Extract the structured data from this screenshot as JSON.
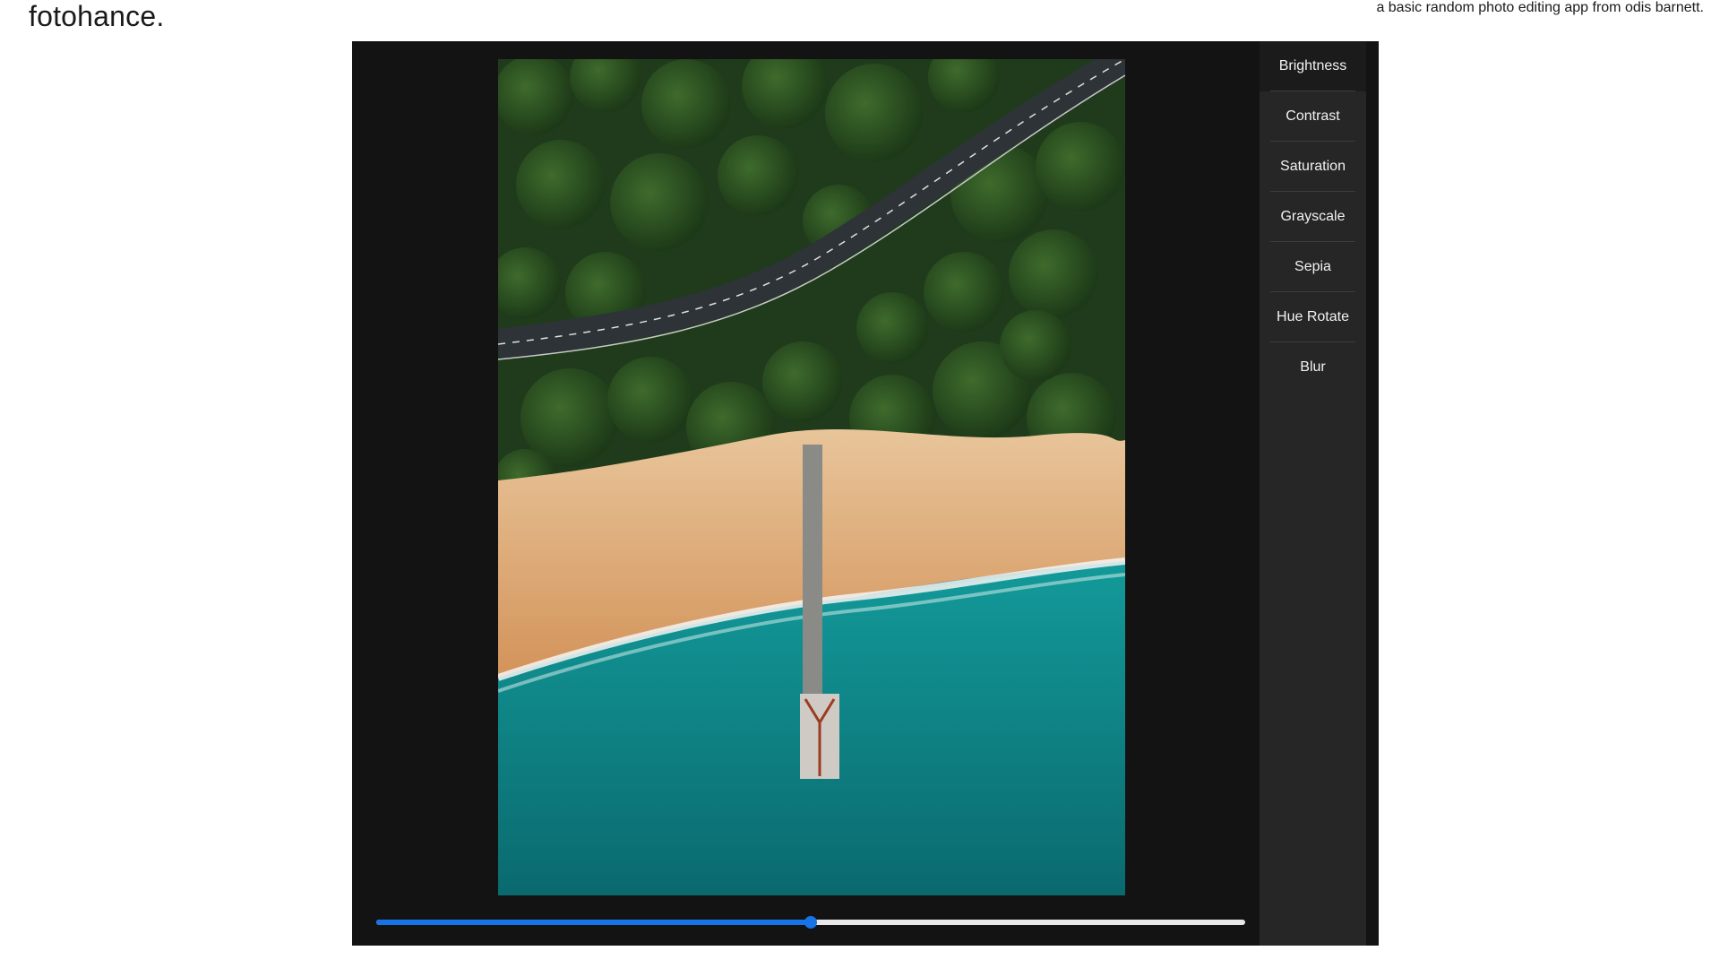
{
  "header": {
    "app_title": "fotohance.",
    "tagline": "a basic random photo editing app from odis barnett."
  },
  "photo": {
    "description_icon": "image",
    "alt": ""
  },
  "sidebar": {
    "items": [
      {
        "label": "Brightness",
        "active": true
      },
      {
        "label": "Contrast",
        "active": false
      },
      {
        "label": "Saturation",
        "active": false
      },
      {
        "label": "Grayscale",
        "active": false
      },
      {
        "label": "Sepia",
        "active": false
      },
      {
        "label": "Hue Rotate",
        "active": false
      },
      {
        "label": "Blur",
        "active": false
      }
    ]
  },
  "slider": {
    "value_fraction": 0.5
  },
  "colors": {
    "accent": "#1773e6",
    "editor_bg": "#131313",
    "sidebar_bg": "#262626",
    "sidebar_active_bg": "#1b1b1b",
    "text_light": "#f2f2f2"
  }
}
